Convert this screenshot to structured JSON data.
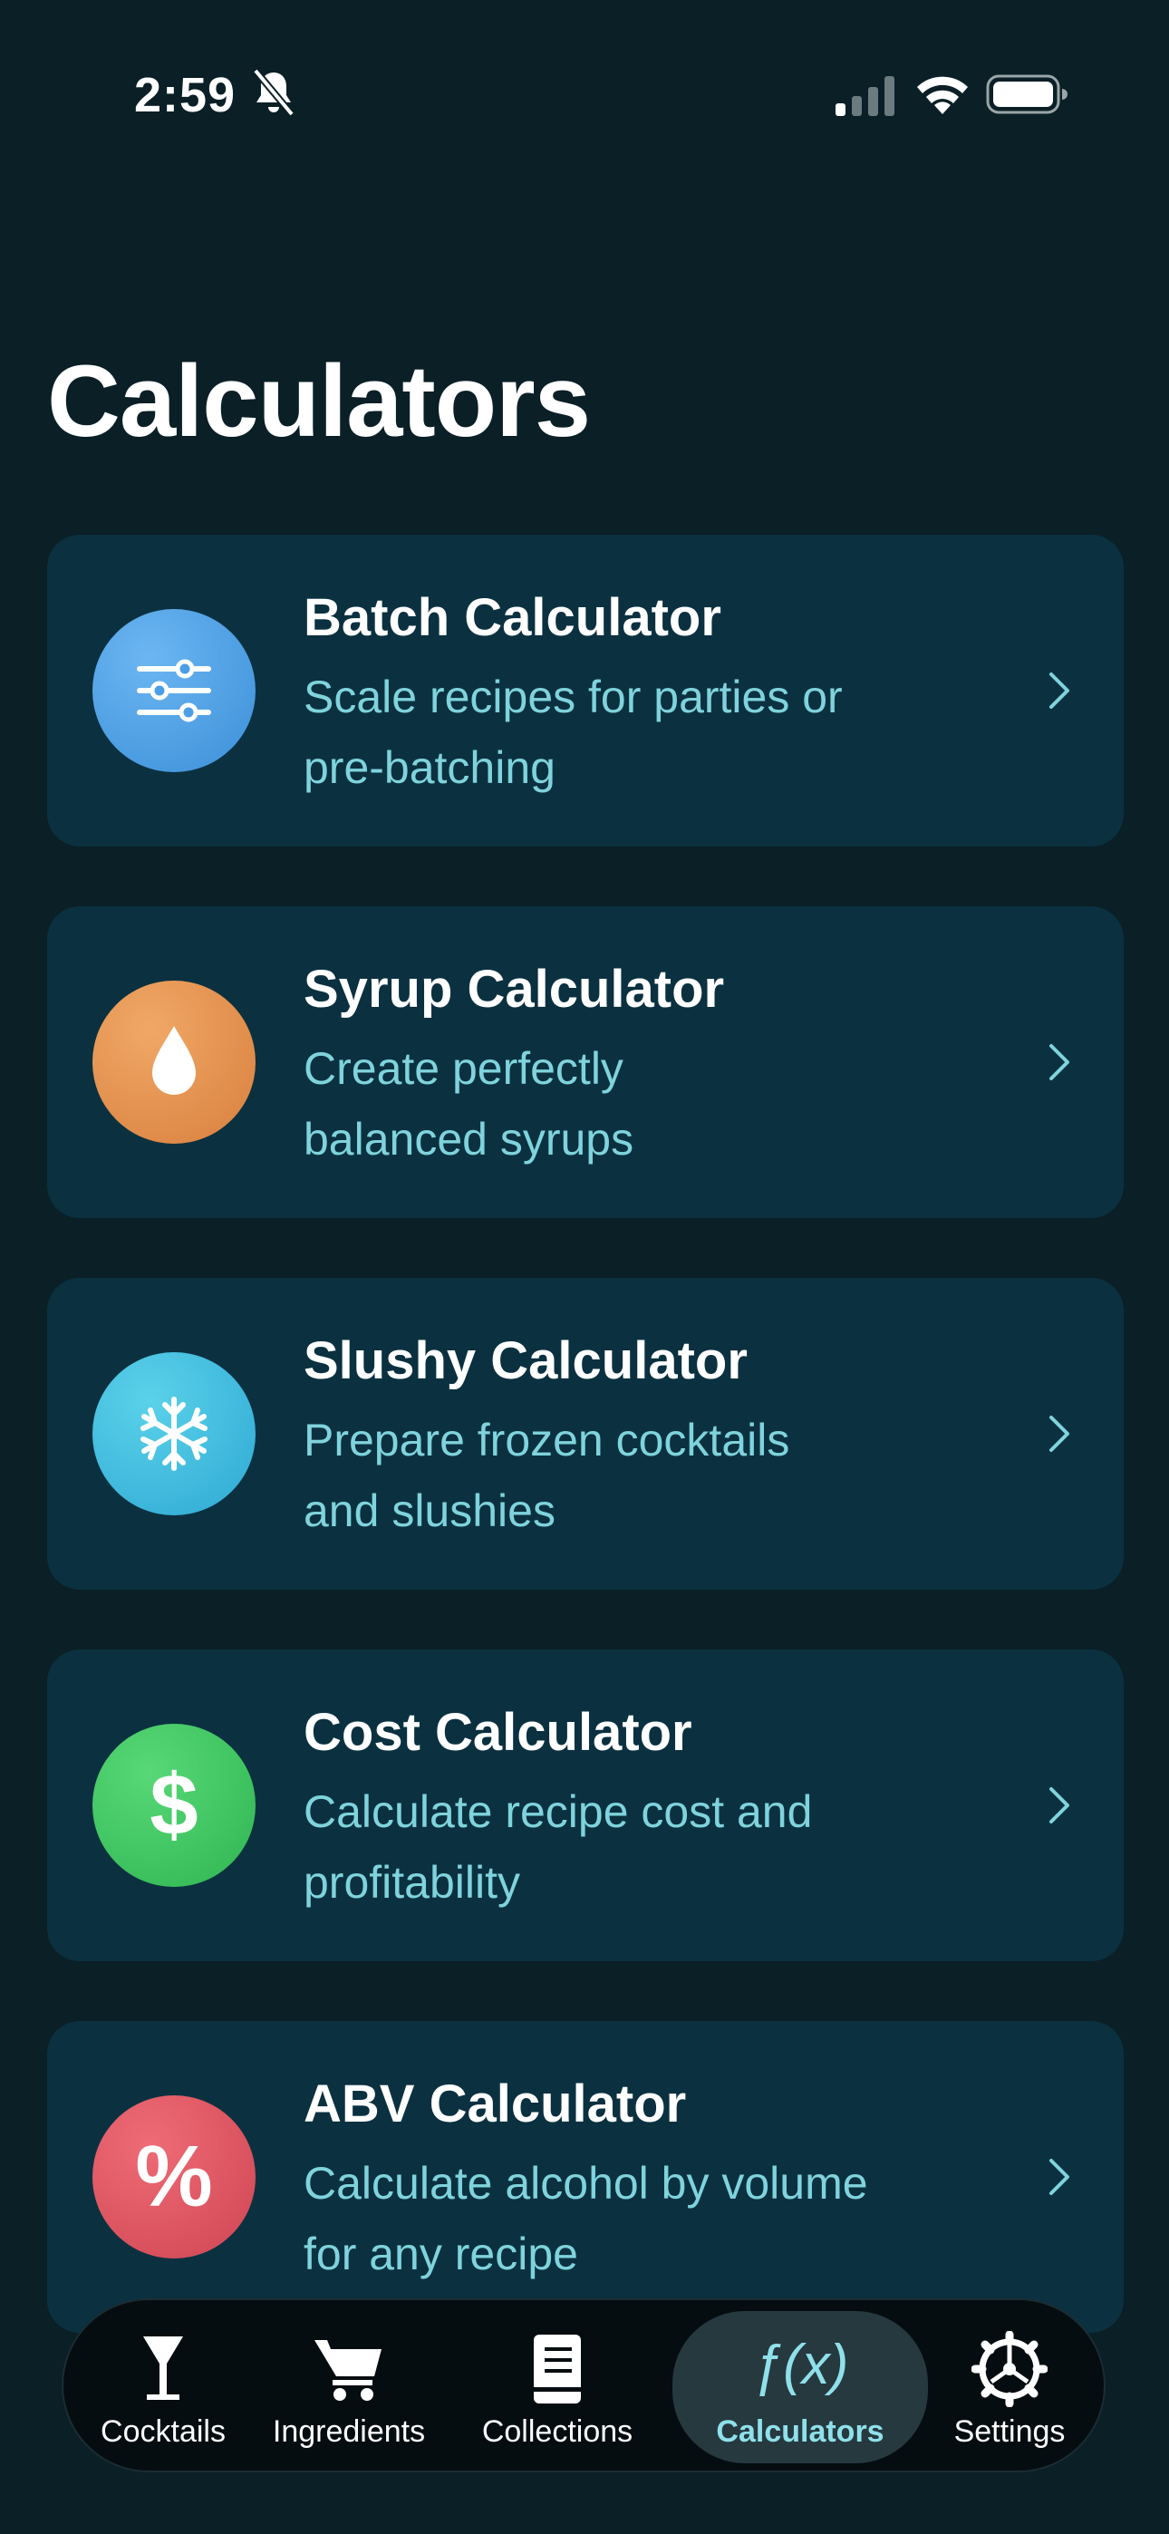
{
  "status": {
    "time": "2:59"
  },
  "page": {
    "title": "Calculators"
  },
  "calculators": [
    {
      "title": "Batch Calculator",
      "desc_line1": "Scale recipes for parties or",
      "desc_line2": "pre-batching",
      "icon": "sliders-icon",
      "color": "#4aa3e8"
    },
    {
      "title": "Syrup Calculator",
      "desc_line1": "Create perfectly",
      "desc_line2": "balanced syrups",
      "icon": "drop-icon",
      "color": "#e8934a"
    },
    {
      "title": "Slushy Calculator",
      "desc_line1": "Prepare frozen cocktails",
      "desc_line2": "and slushies",
      "icon": "snowflake-icon",
      "color": "#3cc6e0"
    },
    {
      "title": "Cost Calculator",
      "desc_line1": "Calculate recipe cost and",
      "desc_line2": "profitability",
      "icon": "dollar-icon",
      "glyph": "$",
      "color": "#3fcf62"
    },
    {
      "title": "ABV Calculator",
      "desc_line1": "Calculate alcohol by volume",
      "desc_line2": "for any recipe",
      "icon": "percent-icon",
      "glyph": "%",
      "color": "#e25561"
    }
  ],
  "tabs": [
    {
      "label": "Cocktails",
      "icon": "cocktail-glass-icon"
    },
    {
      "label": "Ingredients",
      "icon": "cart-icon"
    },
    {
      "label": "Collections",
      "icon": "book-icon"
    },
    {
      "label": "Calculators",
      "icon": "function-icon",
      "active": true,
      "glyph": "ƒ(x)"
    },
    {
      "label": "Settings",
      "icon": "gear-icon"
    }
  ],
  "colors": {
    "background": "#0a1f26",
    "card": "#0b3140",
    "accent": "#7fd3dc"
  }
}
